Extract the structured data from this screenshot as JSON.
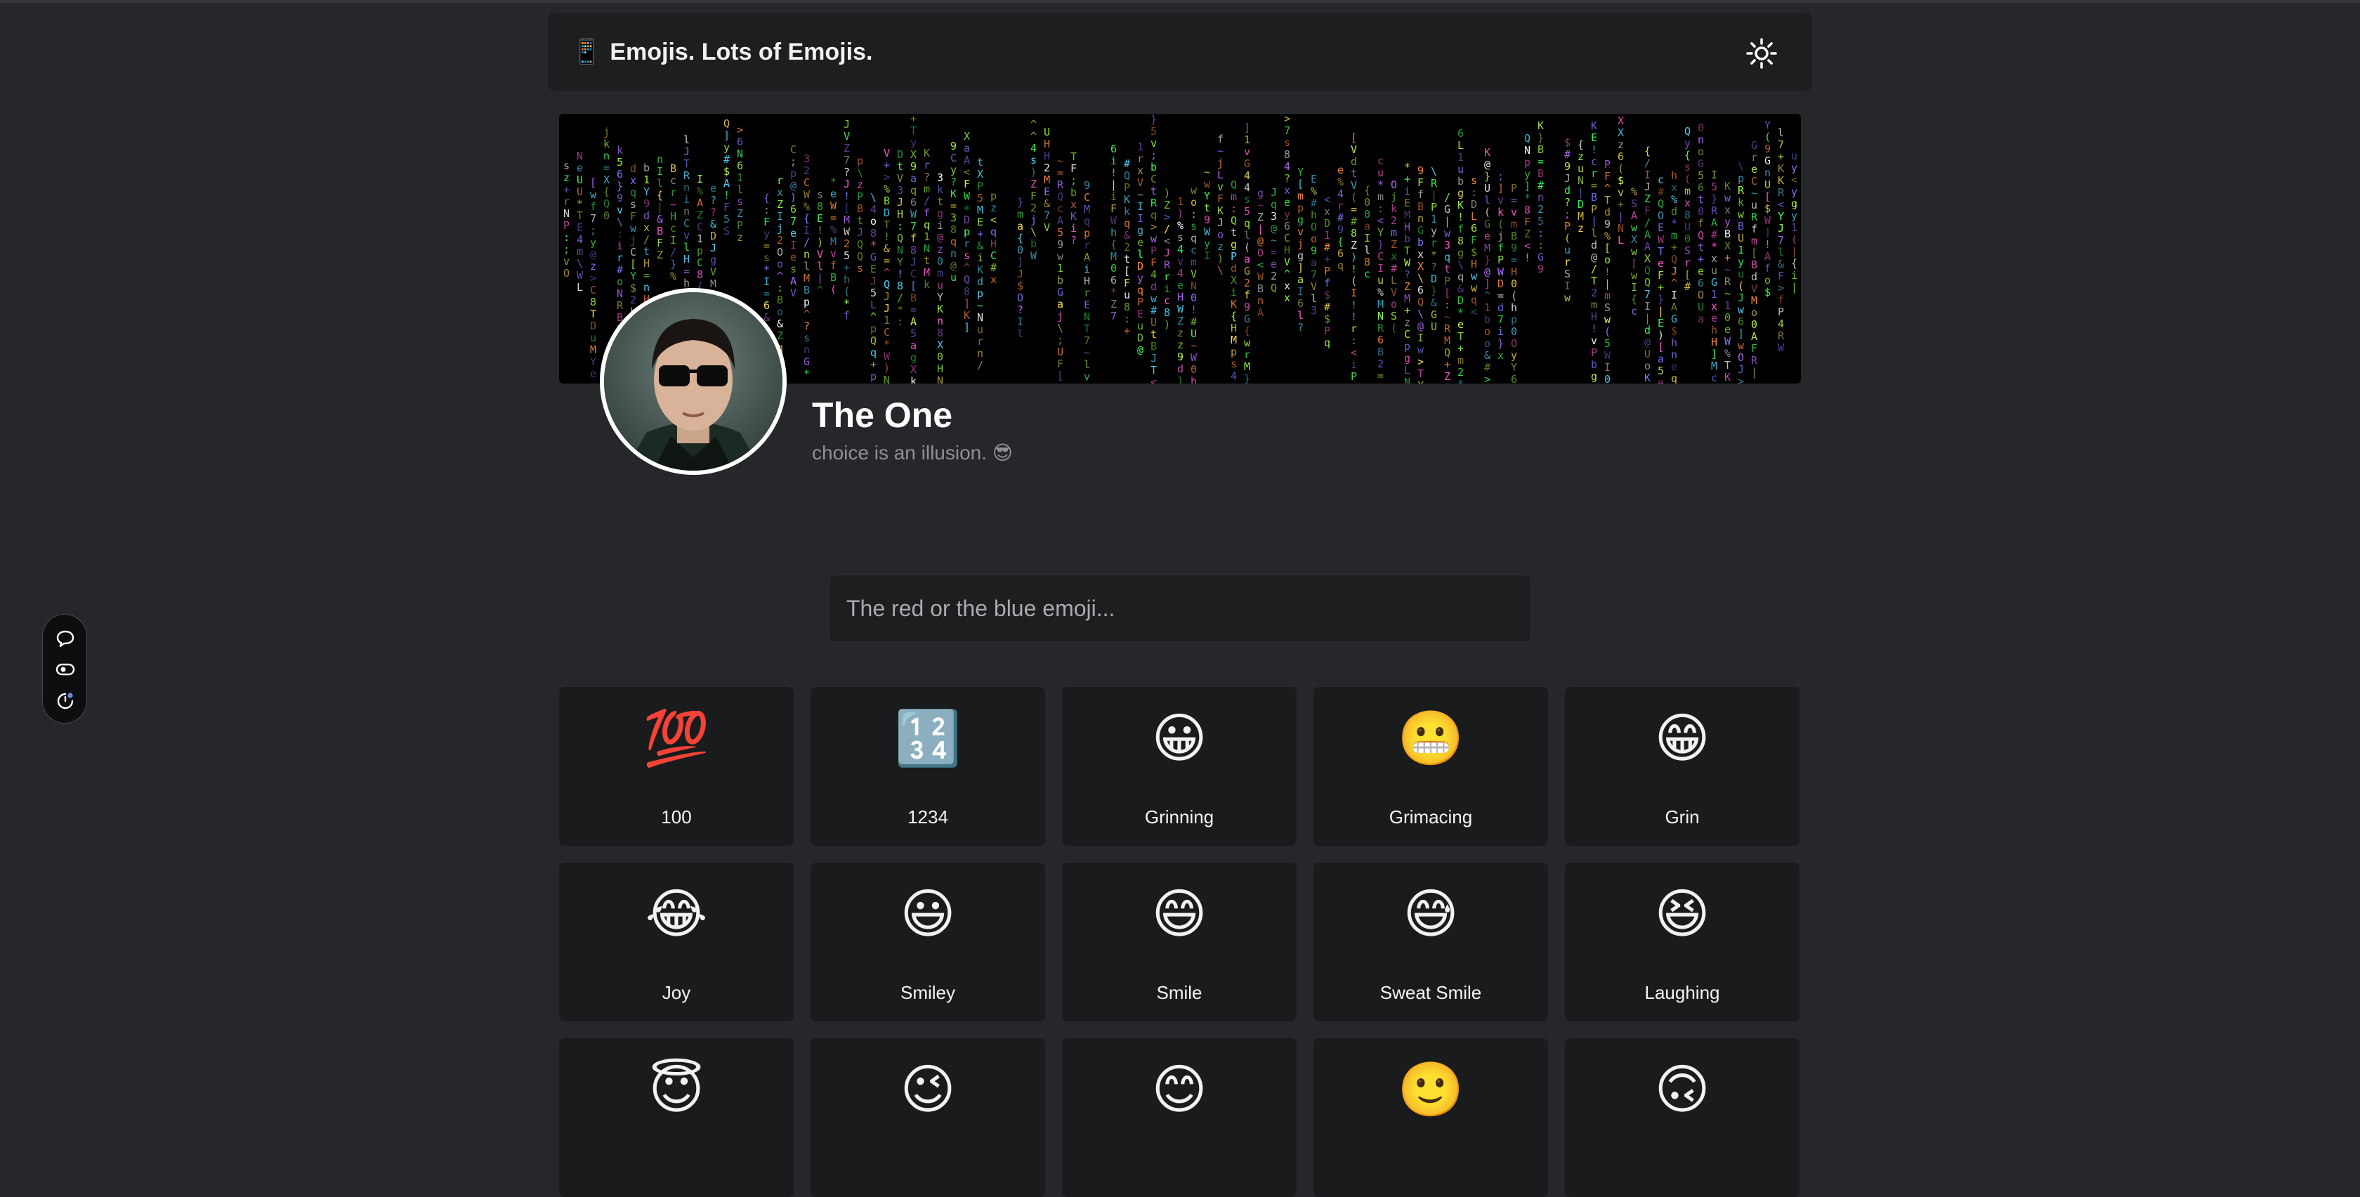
{
  "header": {
    "icon": "📱",
    "title": "Emojis. Lots of Emojis.",
    "theme_icon": "sun-icon"
  },
  "profile": {
    "name": "The One",
    "bio": "choice is an illusion. 😎"
  },
  "search": {
    "placeholder": "The red or the blue emoji..."
  },
  "side_toolbar": {
    "icons": [
      "chat-bubble-icon",
      "toggle-eye-icon",
      "timer-icon"
    ]
  },
  "colors": {
    "background": "#26272a",
    "panel": "#1d1e20",
    "card": "#1a1b1d",
    "matrix": [
      "#3bff5a",
      "#9aff3a",
      "#ffffff",
      "#c9ff4a",
      "#7a7dff",
      "#ff5ad2",
      "#ffe14a",
      "#4ad8ff",
      "#ff8a3a",
      "#b36bff"
    ]
  },
  "emojis": [
    {
      "char": "💯",
      "label": "100"
    },
    {
      "char": "🔢",
      "label": "1234"
    },
    {
      "char": "😀",
      "label": "Grinning"
    },
    {
      "char": "😬",
      "label": "Grimacing"
    },
    {
      "char": "😁",
      "label": "Grin"
    },
    {
      "char": "😂",
      "label": "Joy"
    },
    {
      "char": "😃",
      "label": "Smiley"
    },
    {
      "char": "😄",
      "label": "Smile"
    },
    {
      "char": "😅",
      "label": "Sweat Smile"
    },
    {
      "char": "😆",
      "label": "Laughing"
    },
    {
      "char": "😇",
      "label": ""
    },
    {
      "char": "😉",
      "label": ""
    },
    {
      "char": "😊",
      "label": ""
    },
    {
      "char": "🙂",
      "label": ""
    },
    {
      "char": "🙃",
      "label": ""
    }
  ]
}
